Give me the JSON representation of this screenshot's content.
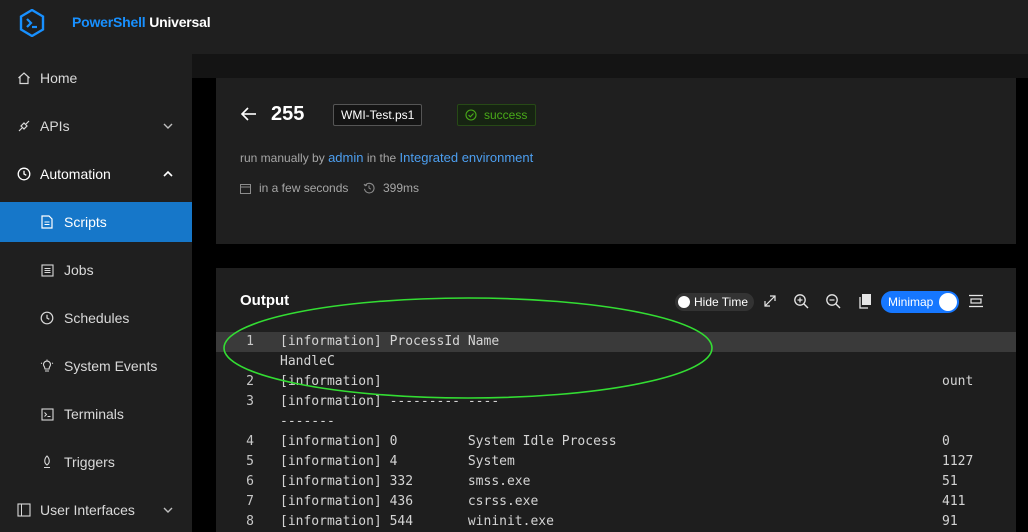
{
  "brand": {
    "part1": "PowerShell",
    "part2": "Universal"
  },
  "sidebar": {
    "home": "Home",
    "apis": "APIs",
    "automation": "Automation",
    "scripts": "Scripts",
    "jobs": "Jobs",
    "schedules": "Schedules",
    "system_events": "System Events",
    "terminals": "Terminals",
    "triggers": "Triggers",
    "user_interfaces": "User Interfaces"
  },
  "job": {
    "id": "255",
    "script": "WMI-Test.ps1",
    "status": "success",
    "run_prefix": "run manually by",
    "user": "admin",
    "in_the": "in the",
    "environment": "Integrated environment",
    "time": "in a few seconds",
    "duration": "399ms"
  },
  "output": {
    "title": "Output",
    "hide_time": "Hide Time",
    "minimap": "Minimap",
    "lines": [
      {
        "n": "1",
        "text": "[information] ProcessId Name",
        "right": ""
      },
      {
        "n": "",
        "text": "HandleC",
        "right": ""
      },
      {
        "n": "2",
        "text": "[information]",
        "right": "ount"
      },
      {
        "n": "3",
        "text": "[information] --------- ----",
        "right": ""
      },
      {
        "n": "",
        "text": "-------",
        "right": ""
      },
      {
        "n": "4",
        "text": "[information] 0         System Idle Process",
        "right": "0"
      },
      {
        "n": "5",
        "text": "[information] 4         System",
        "right": "1127"
      },
      {
        "n": "6",
        "text": "[information] 332       smss.exe",
        "right": "51"
      },
      {
        "n": "7",
        "text": "[information] 436       csrss.exe",
        "right": "411"
      },
      {
        "n": "8",
        "text": "[information] 544       wininit.exe",
        "right": "91"
      }
    ]
  },
  "colors": {
    "accent": "#1677c9",
    "success": "#49aa19",
    "link": "#4d9ff0",
    "annotation": "#33dd33"
  }
}
